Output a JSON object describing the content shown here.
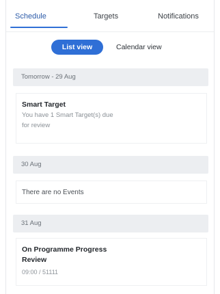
{
  "tabs": [
    {
      "label": "Schedule",
      "active": true
    },
    {
      "label": "Targets",
      "active": false
    },
    {
      "label": "Notifications",
      "active": false
    }
  ],
  "view_toggle": {
    "selected": "List view",
    "other": "Calendar view"
  },
  "days": [
    {
      "header": "Tomorrow - 29 Aug",
      "event": {
        "title": "Smart Target",
        "line1": "You have 1 Smart Target(s) due",
        "line2": "for review"
      }
    },
    {
      "header": "30 Aug",
      "empty_text": "There are no Events"
    },
    {
      "header": "31 Aug",
      "event": {
        "title_line1": "On Programme Progress",
        "title_line2": "Review",
        "time": "09:00 / 51111"
      }
    }
  ],
  "colors": {
    "accent": "#2f6fd6",
    "header_bg": "#eceef1"
  }
}
